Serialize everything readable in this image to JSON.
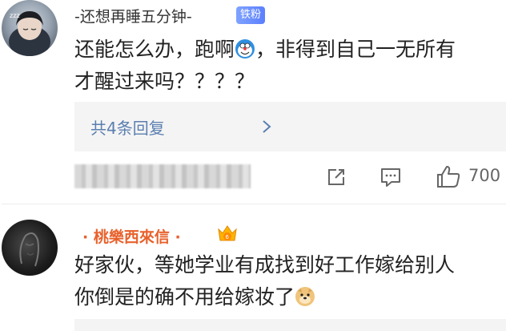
{
  "comments": [
    {
      "username": "-还想再睡五分钟-",
      "badge": "铁粉",
      "text_line1_a": "还能怎么办，跑啊",
      "text_line1_b": "，非得到自己一无所有",
      "text_line2": "才醒过来吗？？？？",
      "emoji": "doraemon-emoji",
      "replies_label": "共4条回复",
      "like_count": "700"
    },
    {
      "username": "· 桃樂西來信 ·",
      "badge_icon": "crown-icon",
      "text_line1": "好家伙，等她学业有成找到好工作嫁给别人",
      "text_line2": "你倒是的确不用给嫁妆了",
      "emoji": "doge-emoji"
    }
  ],
  "colors": {
    "link": "#5b7fb0",
    "vip_name": "#e8612c",
    "fan_badge": "#6b8fff",
    "reply_bg": "#f4f4f4"
  }
}
